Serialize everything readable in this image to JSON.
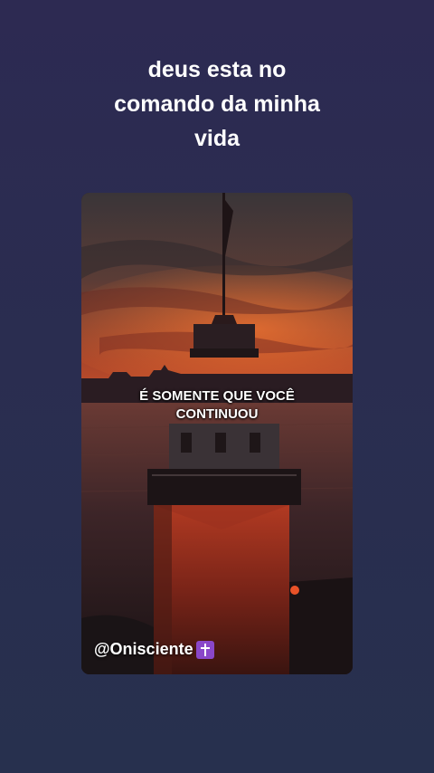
{
  "post": {
    "title_lines": [
      "deus esta no",
      "comando da minha",
      "vida"
    ]
  },
  "video": {
    "caption_lines": [
      "É SOMENTE QUE VOCÊ",
      "CONTINUOU"
    ],
    "watermark": "@Onisciente",
    "watermark_icon": "latin-cross-icon"
  },
  "colors": {
    "background": "#2b2d50",
    "text": "#ffffff",
    "cross_badge": "#8a47c9"
  }
}
